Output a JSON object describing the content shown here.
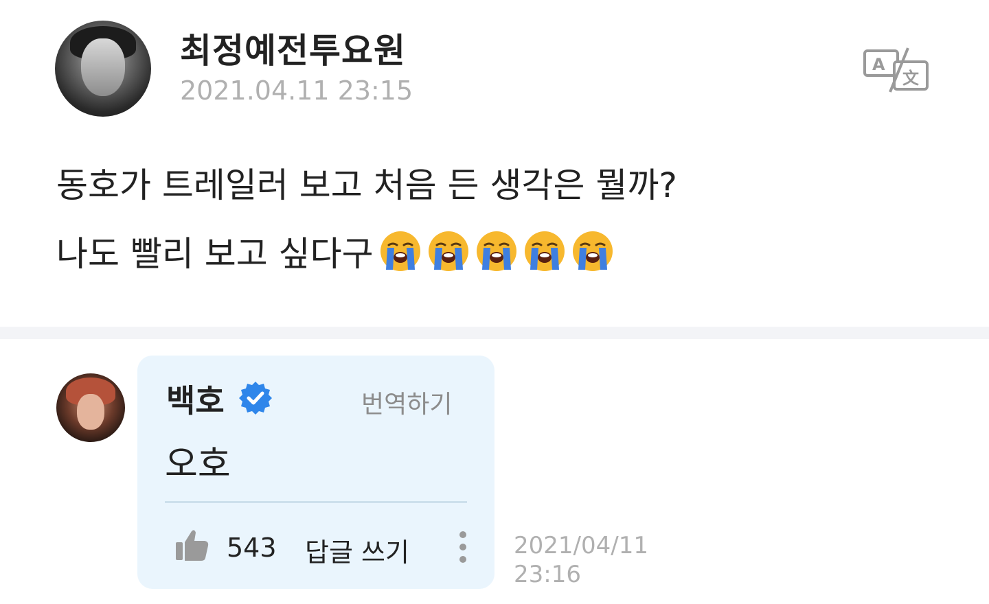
{
  "post": {
    "author": "최정예전투요원",
    "timestamp": "2021.04.11 23:15",
    "line1": "동호가 트레일러 보고 처음 든 생각은 뭘까?",
    "line2": "나도 빨리 보고 싶다구",
    "emoji_count": 5,
    "emoji_name": "loudly-crying-face"
  },
  "comment": {
    "author": "백호",
    "verified": true,
    "translate_label": "번역하기",
    "text": "오호",
    "likes": "543",
    "reply_label": "답글 쓰기",
    "date": "2021/04/11",
    "time": "23:16"
  },
  "icons": {
    "translate": "translate-icon",
    "verified": "verified-badge-icon",
    "like": "thumbs-up-icon",
    "more": "more-vertical-icon"
  },
  "colors": {
    "bubble_bg": "#eaf5fd",
    "verified_blue": "#2f86ea",
    "muted_text": "#b0b0b0",
    "divider": "#f3f4f7"
  }
}
